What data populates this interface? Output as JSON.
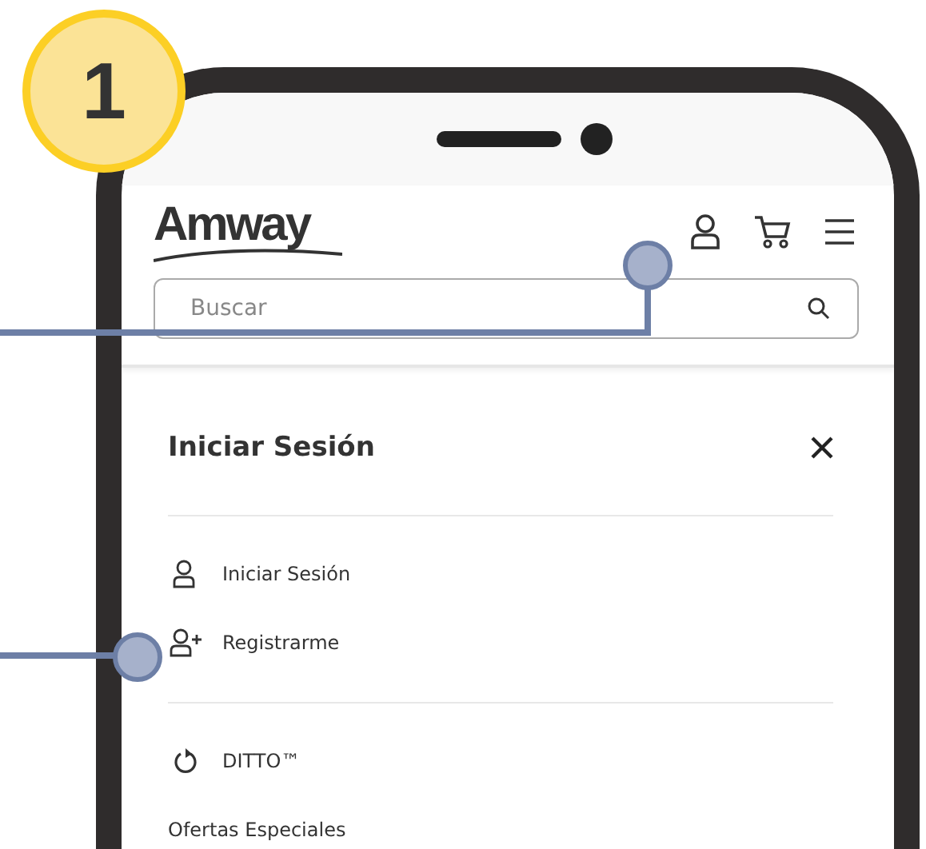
{
  "step_badge": "1",
  "header": {
    "logo": "Amway",
    "search": {
      "placeholder": "Buscar"
    }
  },
  "panel": {
    "title": "Iniciar Sesión",
    "sections": [
      {
        "items": [
          {
            "kind": "user",
            "label": "Iniciar Sesión"
          },
          {
            "kind": "user-add",
            "label": "Registrarme"
          }
        ]
      },
      {
        "items": [
          {
            "kind": "refresh",
            "label": "DITTO™"
          },
          {
            "kind": "none",
            "label": "Ofertas Especiales"
          }
        ]
      }
    ]
  }
}
